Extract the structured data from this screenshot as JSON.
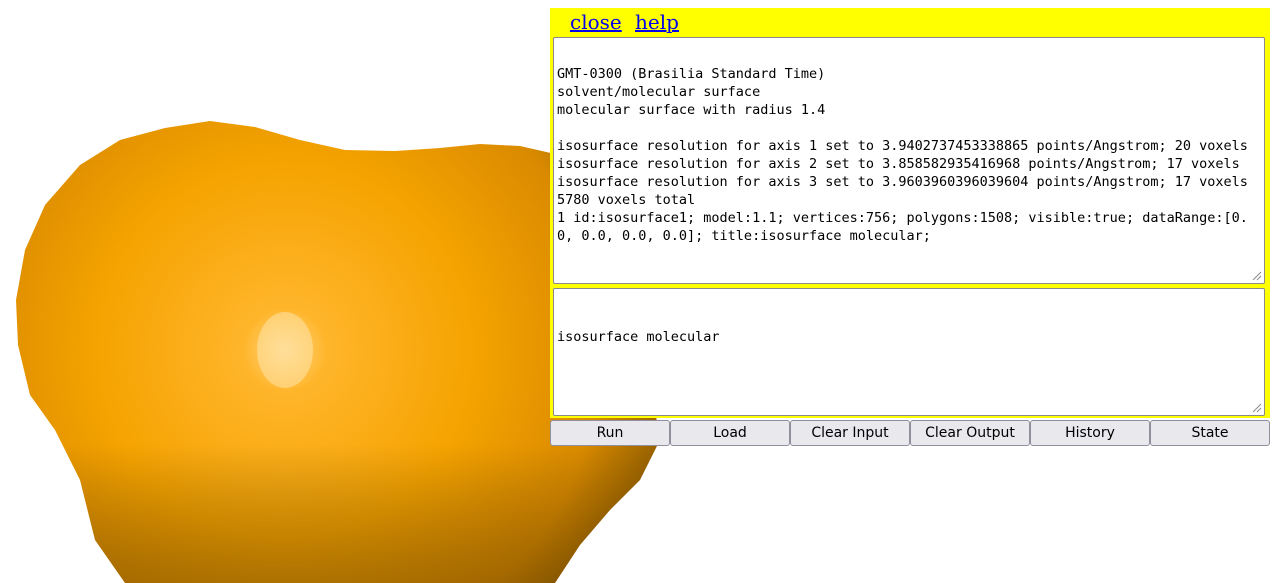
{
  "header": {
    "close_label": "close",
    "help_label": "help"
  },
  "console": {
    "output_text": "GMT-0300 (Brasilia Standard Time)\nsolvent/molecular surface\nmolecular surface with radius 1.4\n\nisosurface resolution for axis 1 set to 3.9402737453338865 points/Angstrom; 20 voxels\nisosurface resolution for axis 2 set to 3.858582935416968 points/Angstrom; 17 voxels\nisosurface resolution for axis 3 set to 3.9603960396039604 points/Angstrom; 17 voxels\n5780 voxels total\n1 id:isosurface1; model:1.1; vertices:756; polygons:1508; visible:true; dataRange:[0.0, 0.0, 0.0, 0.0]; title:isosurface molecular;",
    "input_text": "isosurface molecular"
  },
  "buttons": {
    "run": "Run",
    "load": "Load",
    "clear_input": "Clear Input",
    "clear_output": "Clear Output",
    "history": "History",
    "state": "State"
  },
  "colors": {
    "panel_background": "#ffff00",
    "link": "#0000ee",
    "surface_main": "#f5a500",
    "surface_shadow": "#7a5000",
    "surface_highlight": "#ffd98a"
  }
}
